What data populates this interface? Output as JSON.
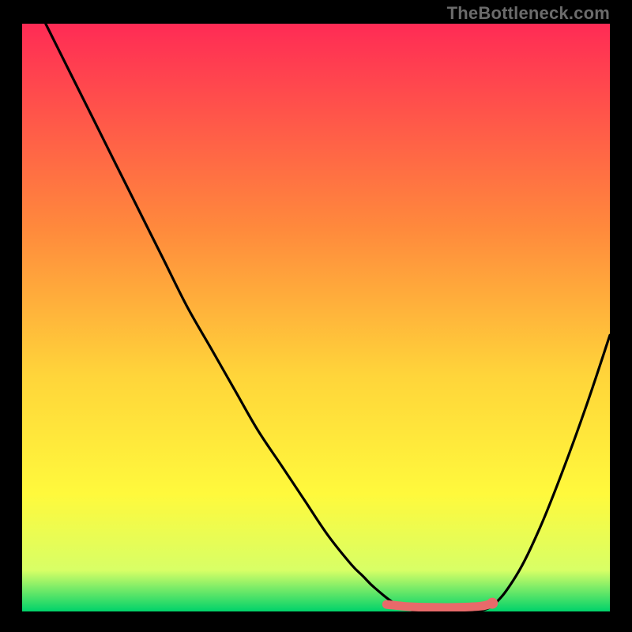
{
  "watermark": "TheBottleneck.com",
  "colors": {
    "top": "#ff2b55",
    "mid1": "#ff8a3c",
    "mid2": "#ffd53a",
    "mid3": "#fff93c",
    "mid4": "#d8ff66",
    "bottom": "#00d26a",
    "curve": "#000000",
    "marker": "#e86a6a"
  },
  "chart_data": {
    "type": "line",
    "title": "",
    "xlabel": "",
    "ylabel": "",
    "xlim": [
      0,
      100
    ],
    "ylim": [
      0,
      100
    ],
    "series": [
      {
        "name": "bottleneck-curve",
        "x": [
          4,
          8,
          12,
          16,
          20,
          24,
          28,
          32,
          36,
          40,
          44,
          48,
          52,
          56,
          58,
          60,
          64,
          68,
          72,
          76,
          80,
          84,
          88,
          92,
          96,
          100
        ],
        "y": [
          100,
          92,
          84,
          76,
          68,
          60,
          52,
          45,
          38,
          31,
          25,
          19,
          13,
          8,
          6,
          4,
          1,
          0,
          0,
          0,
          1,
          6,
          14,
          24,
          35,
          47
        ]
      },
      {
        "name": "optimal-range-marker",
        "x": [
          62,
          66,
          70,
          74,
          78,
          80
        ],
        "y": [
          1.2,
          0.8,
          0.7,
          0.7,
          0.9,
          1.4
        ]
      }
    ],
    "annotations": []
  }
}
